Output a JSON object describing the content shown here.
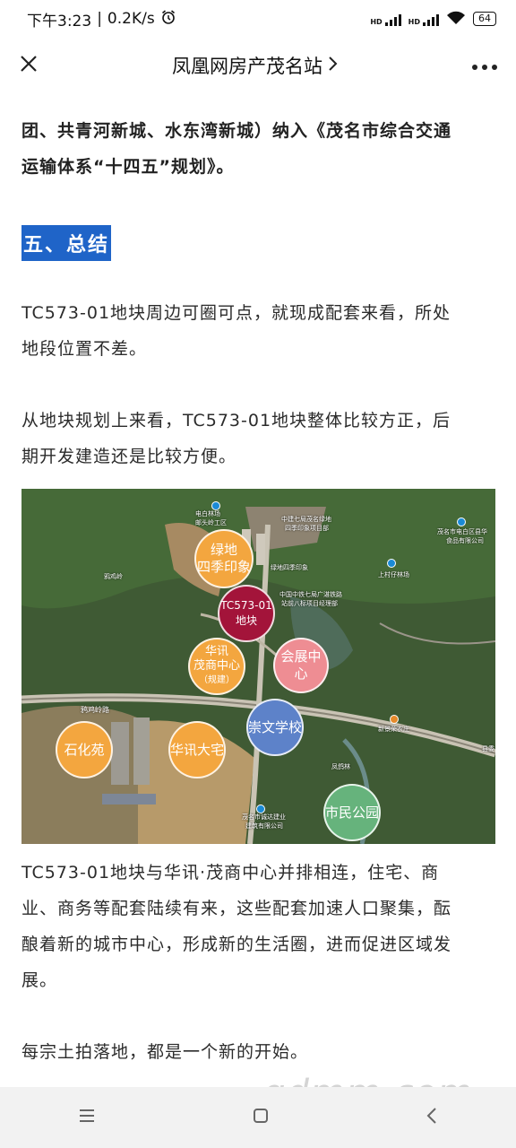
{
  "status_bar": {
    "time": "下午3:23",
    "speed": "0.2K/s",
    "battery": "64",
    "icons": [
      "alarm-icon",
      "hd-signal-icon",
      "wifi-icon",
      "battery-icon"
    ]
  },
  "nav": {
    "title": "凤凰网房产茂名站",
    "close_icon": "close-icon",
    "more_icon": "more-icon"
  },
  "article": {
    "intro_bold_line1": "团、共青河新城、水东湾新城）纳入《茂名市综合交通",
    "intro_bold_line2": "运输体系“十四五”规划》。",
    "heading": "五、总结",
    "para1_line1": "TC573-01地块周边可圈可点，就现成配套来看，所处",
    "para1_line2": "地段位置不差。",
    "para2_line1": "从地块规划上来看，TC573-01地块整体比较方正，后",
    "para2_line2": "期开发建造还是比较方便。",
    "para3_line1": "TC573-01地块与华讯·茂商中心并排相连，住宅、商",
    "para3_line2": "业、商务等配套陆续有来，这些配套加速人口聚集，酝",
    "para3_line3": "酿着新的城市中心，形成新的生活圈，进而促进区域发",
    "para3_line4": "展。",
    "para4_line1": "每宗土拍落地，都是一个新的开始。"
  },
  "map": {
    "bubbles": {
      "lvdi_l1": "绿地",
      "lvdi_l2": "四季印象",
      "plot_l1": "TC573-01",
      "plot_l2": "地块",
      "huaxun_l1": "华讯",
      "huaxun_l2": "茂商中心",
      "huaxun_l3": "（规建）",
      "expo": "会展中心",
      "shihua": "石化苑",
      "huaxun_dazhai": "华讯大宅",
      "chongwen": "崇文学校",
      "park": "市民公园"
    },
    "pois": {
      "p1": "电白林场",
      "p1b": "邮头岭工区",
      "p2": "中建七局茂名绿地",
      "p2b": "四季印象项目部",
      "p3": "绿地四季印象",
      "p4": "中国中铁七局广湛铁路",
      "p4b": "站前八标项目经理部",
      "p5": "上村仔林场",
      "p6": "茂名市电白区县华",
      "p6b": "食品有限公司",
      "p7": "鸦鸡岭",
      "p8": "新景荣农庄",
      "p9": "凤鸽林",
      "p10": "茂名市诚达建业",
      "p10b": "建筑有限公司",
      "p11": "鸦鸡岭路",
      "p12": "县委"
    }
  },
  "watermark": "gdmm.com",
  "system_nav": {
    "menu_icon": "menu-icon",
    "home_icon": "home-icon",
    "back_icon": "back-icon"
  }
}
